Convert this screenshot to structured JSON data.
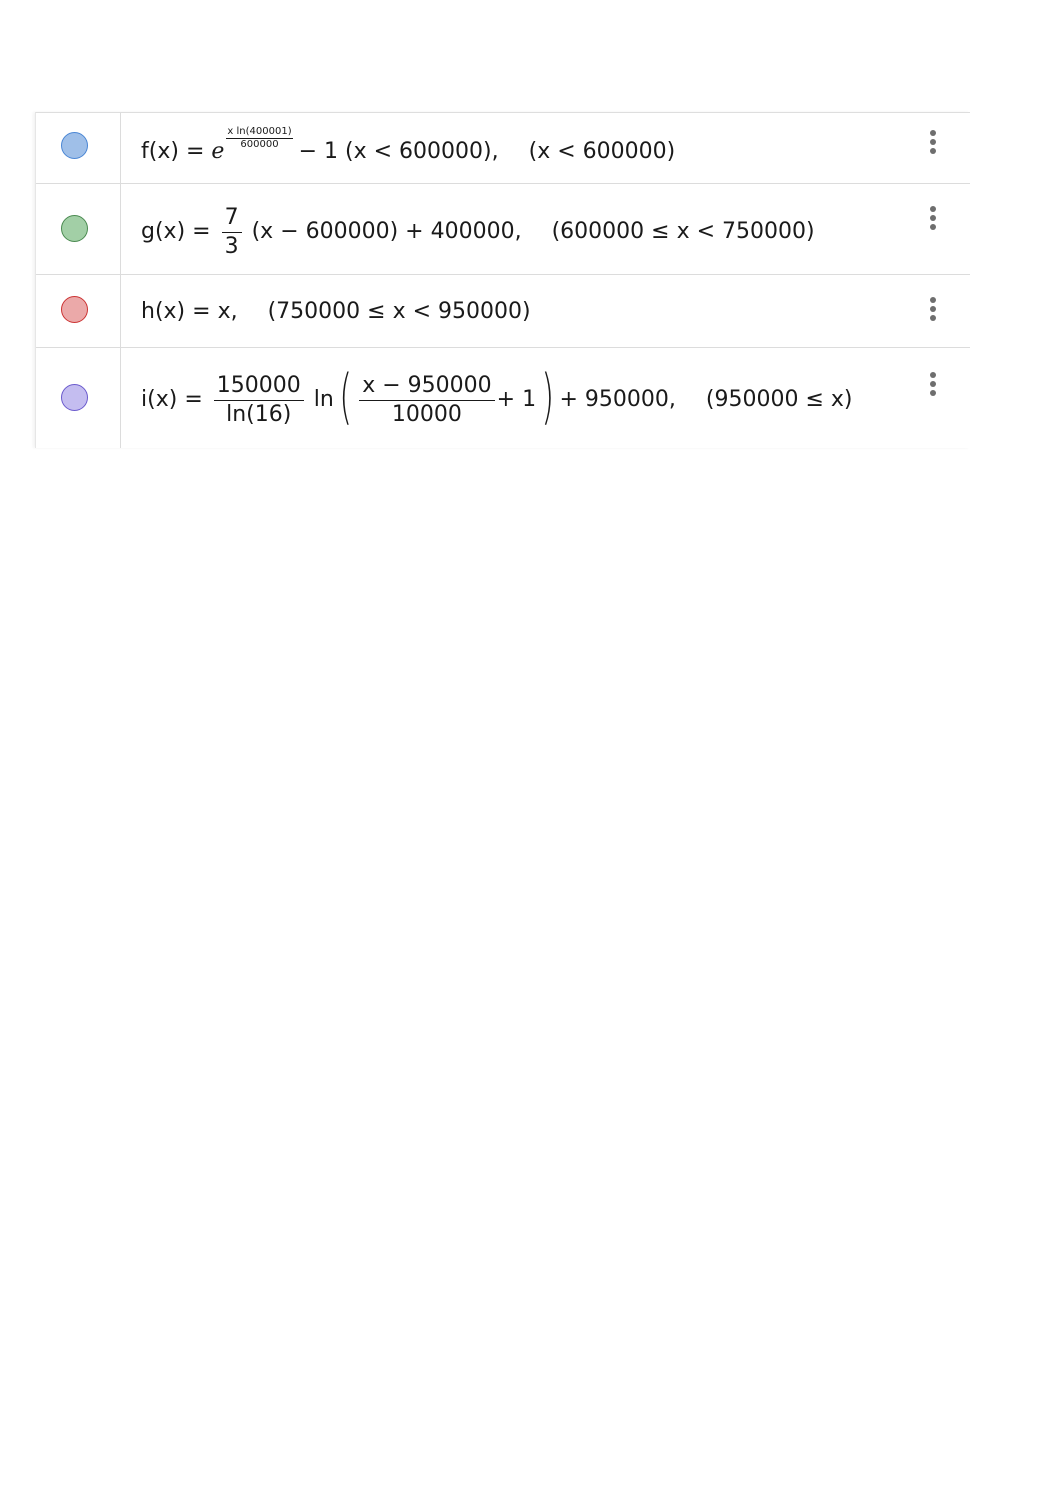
{
  "algebra_view": {
    "rows": [
      {
        "name": "f",
        "color": "#9fbfe8",
        "border_color": "#4a86d4",
        "lhs": "f(x)",
        "equals": "=",
        "base": "e",
        "exp_num": "x ln(400001)",
        "exp_den": "600000",
        "tail": "− 1 (x < 600000),",
        "condition": "(x < 600000)"
      },
      {
        "name": "g",
        "color": "#a2cfa6",
        "border_color": "#4a8a50",
        "lhs": "g(x)",
        "equals": "=",
        "frac_num": "7",
        "frac_den": "3",
        "tail": "(x − 600000) + 400000,",
        "condition": "(600000 ≤ x < 750000)"
      },
      {
        "name": "h",
        "color": "#eba9a9",
        "border_color": "#cc3333",
        "lhs": "h(x)",
        "equals": "=",
        "tail": "x,",
        "condition": "(750000 ≤ x < 950000)"
      },
      {
        "name": "i",
        "color": "#c4bdf0",
        "border_color": "#6a5acd",
        "lhs": "i(x)",
        "equals": "=",
        "frac_num": "150000",
        "frac_den": "ln(16)",
        "ln": "ln",
        "lparen": "(",
        "inner_num": "x − 950000",
        "inner_den": "10000",
        "inner_tail": "+ 1",
        "rparen": ")",
        "tail": "+ 950000,",
        "condition": "(950000 ≤ x)"
      }
    ],
    "menu_icon": "more-vert-icon"
  }
}
